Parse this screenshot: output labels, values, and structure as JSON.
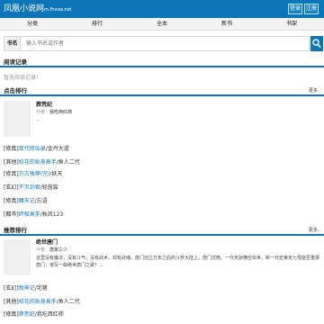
{
  "header": {
    "logo_text": "凤凰小说网",
    "logo_domain": "m.fhxsw.net",
    "login_label": "登录",
    "register_label": "注册"
  },
  "nav": [
    "分类",
    "排行",
    "全本",
    "新书",
    "书架"
  ],
  "search": {
    "label": "书名",
    "placeholder": "输入书名或作者"
  },
  "reading_history": {
    "title": "阅读记录",
    "empty_text": "暂无阅读记录！"
  },
  "click_rank": {
    "title": "点击排行",
    "more": "更多..",
    "featured": {
      "title": "葬荒纪",
      "author_label": "作者：",
      "author": "我吃西红柿",
      "desc": "..."
    },
    "items": [
      {
        "category": "[修真]",
        "title": "现代修仙录",
        "author": "/金丹大道"
      },
      {
        "category": "[其他]",
        "title": "校花的贴身高手",
        "author": "/鱼人二代"
      },
      {
        "category": "[修真]",
        "title": "万古独尊(完)",
        "author": "/妖天"
      },
      {
        "category": "[玄幻]",
        "title": "不灭剑君",
        "author": "/轻茵宸"
      },
      {
        "category": "[修真]",
        "title": "魔天记",
        "author": "/忘语"
      },
      {
        "category": "[都市]",
        "title": "终极高手",
        "author": "/秋风123"
      }
    ]
  },
  "recommend_rank": {
    "title": "推荐排行",
    "more": "更多..",
    "featured": {
      "title": "绝世唐门",
      "author_label": "作者：",
      "author": "唐家三少",
      "desc": "这里没有魔法，没有斗气，没有武术，却有武魂。唐门创立万年之后的斗罗大陆上，唐门式微。一代天骄横空出世，新一代史莱克七怪能否重振唐门，谱写一曲绝世唐门之歌？..."
    },
    "items": [
      {
        "category": "[玄幻]",
        "title": "牧神记",
        "author": "/宅猪"
      },
      {
        "category": "[其他]",
        "title": "校花的贴身高手",
        "author": "/鱼人二代"
      },
      {
        "category": "[修真]",
        "title": "莽荒纪",
        "author": "/我吃西红柿"
      }
    ]
  }
}
